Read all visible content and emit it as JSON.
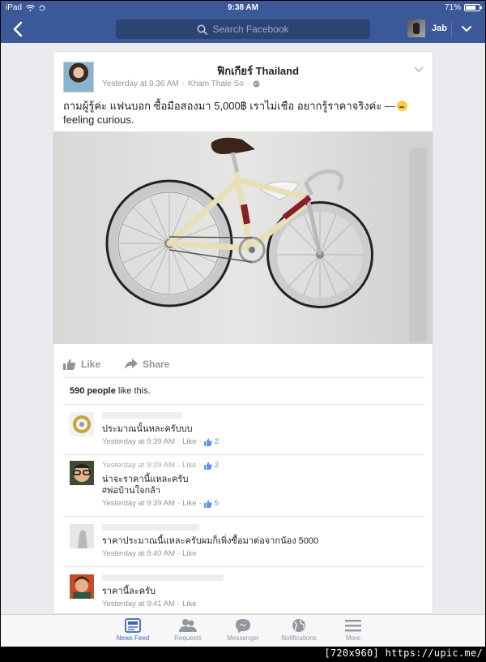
{
  "status_bar": {
    "device": "iPad",
    "time": "9:38 AM",
    "battery": "71%"
  },
  "nav": {
    "search_placeholder": "Search Facebook",
    "profile_name": "Jab"
  },
  "post": {
    "author": "ฟิกเกียร์ Thailand",
    "timestamp": "Yesterday at 9:36 AM",
    "location": "Kham Thale So",
    "text": "ถามผู้รู้ค่ะ แฟนบอก ซื้อมือสองมา 5,000฿ เราไม่เชือ อยากรู้ราคาจริงค่ะ —",
    "feeling": "feeling curious.",
    "like_label": "Like",
    "share_label": "Share",
    "likes_count": "590 people",
    "likes_suffix": "like this."
  },
  "comments": [
    {
      "text": "ประมาณนั้นหละครับบบ",
      "time": "Yesterday at 9:39 AM",
      "like": "Like",
      "likes": "2"
    },
    {
      "text": "น่าจะราคานี้แหละครับ",
      "text2": "#พ่อบ้านใจกล้า",
      "time_top": "Yesterday at 9:39 AM",
      "like_top": "Like",
      "likes_top": "2",
      "time": "Yesterday at 9:39 AM",
      "like": "Like",
      "likes": "5"
    },
    {
      "text": "ราคาประมาณนี้แหละครับผมก็เพิ่งซื้อมาต่อจากน้อง 5000",
      "time": "Yesterday at 9:40 AM",
      "like": "Like"
    },
    {
      "text": "ราคานี้ละครับ",
      "time": "Yesterday at 9:41 AM",
      "like": "Like"
    }
  ],
  "tabs": [
    {
      "label": "News Feed",
      "icon": "news-feed-icon",
      "active": true
    },
    {
      "label": "Requests",
      "icon": "friend-requests-icon"
    },
    {
      "label": "Messenger",
      "icon": "messenger-icon"
    },
    {
      "label": "Notifications",
      "icon": "globe-icon"
    },
    {
      "label": "More",
      "icon": "menu-icon"
    }
  ],
  "watermark": "[720x960] https://upic.me/",
  "colors": {
    "brand": "#3b5998",
    "link": "#4267b2",
    "meta": "#90949c"
  }
}
